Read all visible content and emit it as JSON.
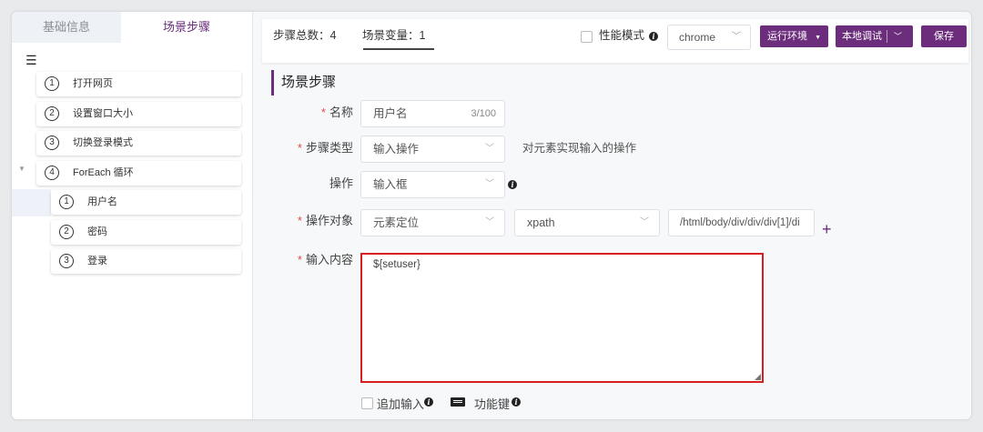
{
  "left_panel": {
    "tabs": [
      {
        "label": "基础信息"
      },
      {
        "label": "场景步骤"
      }
    ],
    "menu_icon": "hamburger-icon",
    "steps": [
      {
        "num": "1",
        "label": "打开网页"
      },
      {
        "num": "2",
        "label": "设置窗口大小"
      },
      {
        "num": "3",
        "label": "切换登录模式"
      },
      {
        "num": "4",
        "label": "ForEach 循环"
      }
    ],
    "sub_steps": [
      {
        "num": "1",
        "label": "用户名"
      },
      {
        "num": "2",
        "label": "密码"
      },
      {
        "num": "3",
        "label": "登录"
      }
    ]
  },
  "toolbar": {
    "step_total": "步骤总数：4",
    "scene_vars": "场景变量：1",
    "perf_mode": "性能模式",
    "browser": "chrome",
    "run_env": "运行环境",
    "local_debug": "本地调试",
    "save": "保存"
  },
  "form": {
    "section_title": "场景步骤",
    "name_label": "名称",
    "name_value": "用户名",
    "name_count": "3/100",
    "step_type_label": "步骤类型",
    "step_type_value": "输入操作",
    "step_type_desc": "对元素实现输入的操作",
    "op_label": "操作",
    "op_value": "输入框",
    "target_label": "操作对象",
    "target_type": "元素定位",
    "locator_type": "xpath",
    "locator_value": "/html/body/div/div/div[1]/di",
    "content_label": "输入内容",
    "content_value": "${setuser}",
    "append_input": "追加输入",
    "func_keys": "功能键"
  },
  "colors": {
    "accent": "#6b2d7c",
    "required": "#e24b4b",
    "error_border": "#d81e1e"
  }
}
